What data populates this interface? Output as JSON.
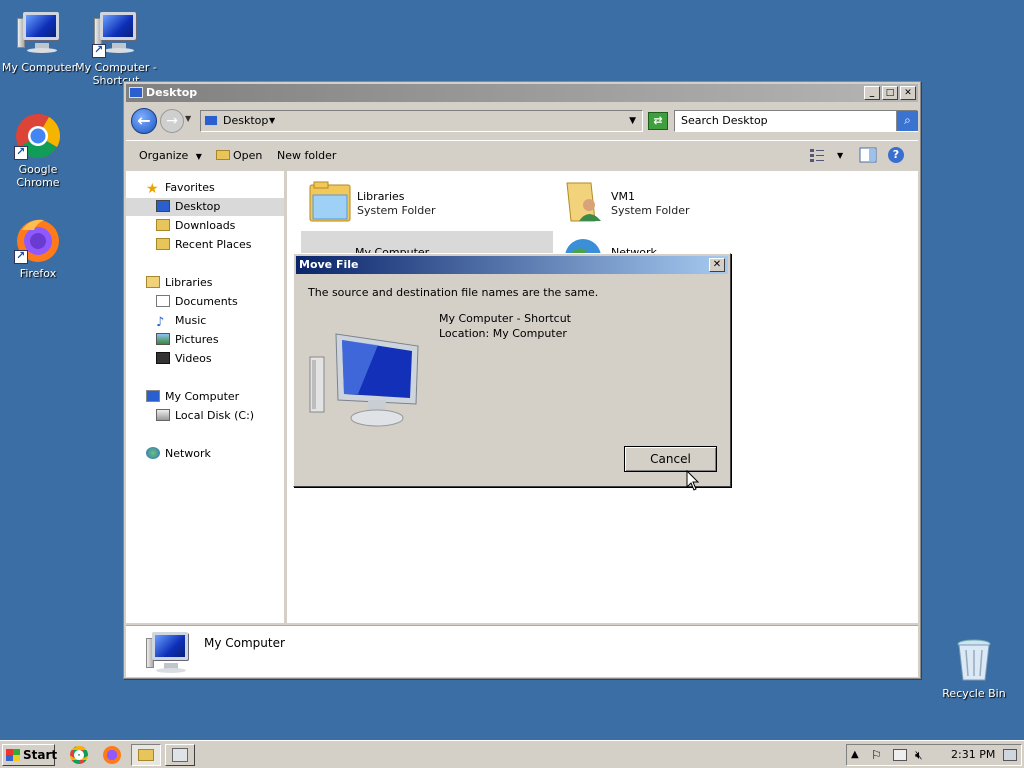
{
  "desktop": {
    "icons": [
      {
        "label": "My Computer"
      },
      {
        "label": "My Computer - Shortcut"
      },
      {
        "label": "Google Chrome"
      },
      {
        "label": "Firefox"
      },
      {
        "label": "Recycle Bin"
      }
    ]
  },
  "explorer": {
    "title": "Desktop",
    "address": "Desktop",
    "search_placeholder": "Search Desktop",
    "toolbar": {
      "organize": "Organize",
      "open": "Open",
      "new_folder": "New folder"
    },
    "nav": {
      "favorites": "Favorites",
      "desktop": "Desktop",
      "downloads": "Downloads",
      "recent_places": "Recent Places",
      "libraries": "Libraries",
      "documents": "Documents",
      "music": "Music",
      "pictures": "Pictures",
      "videos": "Videos",
      "my_computer": "My Computer",
      "local_disk": "Local Disk (C:)",
      "network": "Network"
    },
    "files": [
      {
        "name": "Libraries",
        "type": "System Folder"
      },
      {
        "name": "VM1",
        "type": "System Folder"
      },
      {
        "name": "My Computer",
        "type": ""
      },
      {
        "name": "Network",
        "type": ""
      }
    ],
    "details": {
      "name": "My Computer"
    }
  },
  "dialog": {
    "title": "Move File",
    "message": "The source and destination file names are the same.",
    "file_name": "My Computer - Shortcut",
    "location": "Location: My Computer",
    "cancel": "Cancel"
  },
  "taskbar": {
    "start": "Start",
    "clock": "2:31 PM"
  }
}
